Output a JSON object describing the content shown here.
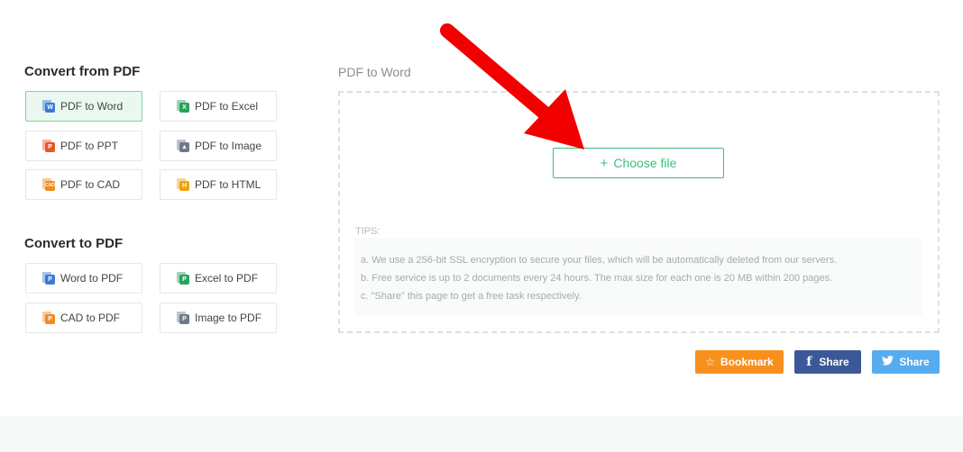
{
  "left": {
    "convert_from_title": "Convert from PDF",
    "convert_from_items": [
      {
        "label": "PDF to Word",
        "badge": "W",
        "color": "#3a7bd5"
      },
      {
        "label": "PDF to Excel",
        "badge": "X",
        "color": "#27a35a"
      },
      {
        "label": "PDF to PPT",
        "badge": "P",
        "color": "#e8562a"
      },
      {
        "label": "PDF to Image",
        "badge": "▲",
        "color": "#6c7a89"
      },
      {
        "label": "PDF to CAD",
        "badge": "CAD",
        "color": "#f08a24"
      },
      {
        "label": "PDF to HTML",
        "badge": "H",
        "color": "#f2a20c"
      }
    ],
    "convert_to_title": "Convert to PDF",
    "convert_to_items": [
      {
        "label": "Word to PDF",
        "badge": "P",
        "color": "#3a7bd5"
      },
      {
        "label": "Excel to PDF",
        "badge": "P",
        "color": "#27a35a"
      },
      {
        "label": "CAD to PDF",
        "badge": "P",
        "color": "#f08a24"
      },
      {
        "label": "Image to PDF",
        "badge": "P",
        "color": "#6c7a89"
      }
    ]
  },
  "panel": {
    "title": "PDF to Word",
    "choose_file": "Choose file",
    "tips_label": "TIPS:",
    "tips": [
      "a. We use a 256-bit SSL encryption to secure your files, which will be automatically deleted from our servers.",
      "b. Free service is up to 2 documents every 24 hours. The max size for each one is 20 MB within 200 pages.",
      "c. \"Share\" this page to get a free task respectively."
    ]
  },
  "share": {
    "bookmark": "Bookmark",
    "facebook": "Share",
    "twitter": "Share"
  },
  "colors": {
    "accent": "#3cbf7e",
    "bookmark": "#f8901d",
    "facebook": "#3b5998",
    "twitter": "#55acee",
    "arrow": "#f20000"
  }
}
